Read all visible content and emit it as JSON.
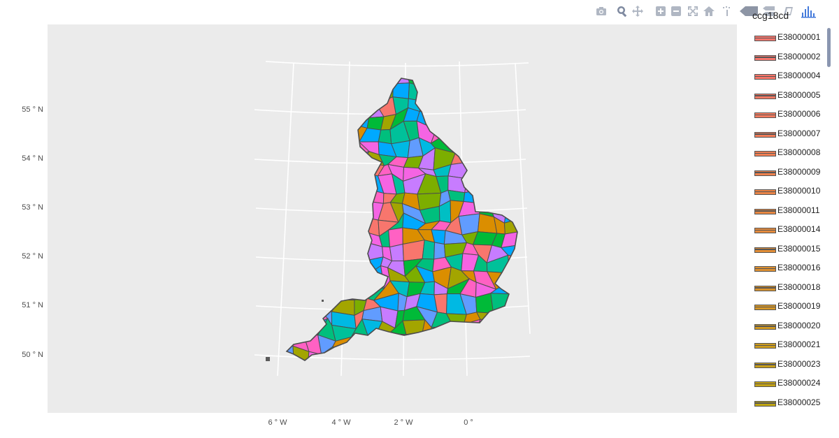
{
  "legend": {
    "title": "ccg18cd",
    "items": [
      {
        "label": "E38000001",
        "color": "#f8766d"
      },
      {
        "label": "E38000002",
        "color": "#f8766d"
      },
      {
        "label": "E38000004",
        "color": "#f7766a"
      },
      {
        "label": "E38000005",
        "color": "#f57964"
      },
      {
        "label": "E38000006",
        "color": "#f47b5f"
      },
      {
        "label": "E38000007",
        "color": "#f27d59"
      },
      {
        "label": "E38000008",
        "color": "#f07f53"
      },
      {
        "label": "E38000009",
        "color": "#ed814d"
      },
      {
        "label": "E38000010",
        "color": "#ea8447"
      },
      {
        "label": "E38000011",
        "color": "#e78742"
      },
      {
        "label": "E38000014",
        "color": "#e48a3c"
      },
      {
        "label": "E38000015",
        "color": "#e18d36"
      },
      {
        "label": "E38000016",
        "color": "#dd9031"
      },
      {
        "label": "E38000018",
        "color": "#d9932c"
      },
      {
        "label": "E38000019",
        "color": "#d59627"
      },
      {
        "label": "E38000020",
        "color": "#d19922"
      },
      {
        "label": "E38000021",
        "color": "#cd9c1e"
      },
      {
        "label": "E38000023",
        "color": "#c99f1a"
      },
      {
        "label": "E38000024",
        "color": "#c4a216"
      },
      {
        "label": "E38000025",
        "color": "#c0a512"
      }
    ]
  },
  "axes": {
    "y_ticks": [
      {
        "label": "55 ° N",
        "value": 55
      },
      {
        "label": "54 ° N",
        "value": 54
      },
      {
        "label": "53 ° N",
        "value": 53
      },
      {
        "label": "52 ° N",
        "value": 52
      },
      {
        "label": "51 ° N",
        "value": 51
      },
      {
        "label": "50 ° N",
        "value": 50
      }
    ],
    "x_ticks": [
      {
        "label": "6 ° W",
        "value": -6
      },
      {
        "label": "4 ° W",
        "value": -4
      },
      {
        "label": "2 ° W",
        "value": -2
      },
      {
        "label": "0 °",
        "value": 0
      }
    ]
  },
  "modebar": {
    "icons": [
      "camera-icon",
      "zoom-icon",
      "pan-icon",
      "zoom-in-icon",
      "zoom-out-icon",
      "autoscale-icon",
      "home-icon",
      "spike-lines-icon",
      "hover-closest-icon",
      "hover-compare-icon",
      "lasso-icon",
      "plotly-logo-icon"
    ]
  },
  "colors": {
    "panel": "#ebebeb",
    "grid": "#ffffff",
    "border": "#4d4d4d",
    "modebar_icon": "#b0b7c3",
    "plotly_logo": "#447adb"
  },
  "map_palette": [
    "#f8766d",
    "#ff61c3",
    "#619cff",
    "#00a9ff",
    "#00b9e3",
    "#00bfc4",
    "#00c19a",
    "#00ba38",
    "#7cae00",
    "#a3a500",
    "#db8e00",
    "#c77cff",
    "#f564e3",
    "#00bf7d"
  ]
}
